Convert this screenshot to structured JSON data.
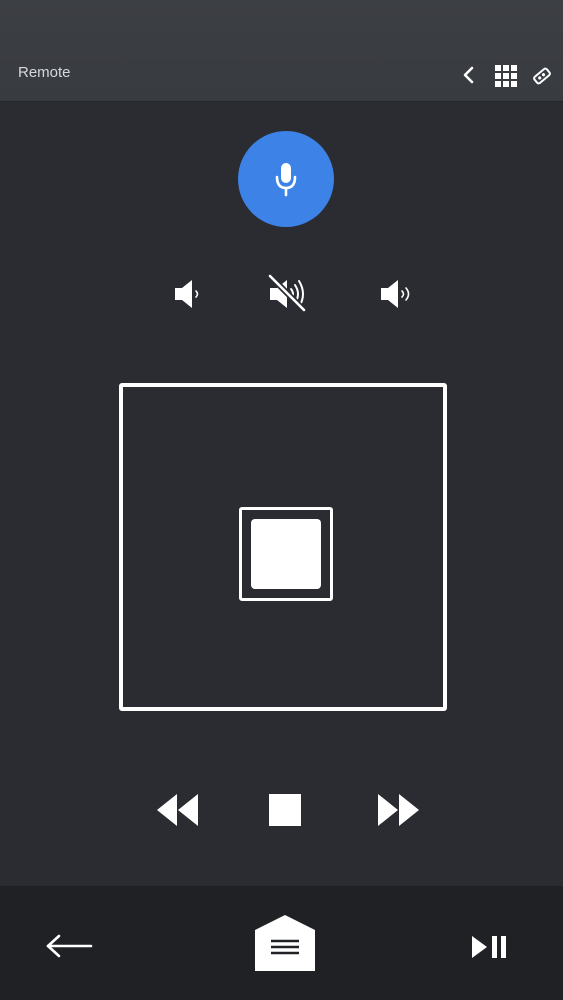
{
  "header": {
    "title": "Remote",
    "icons": [
      "chevron-left-icon",
      "grid-icon",
      "remote-icon"
    ]
  },
  "voice": {
    "icon": "microphone-icon",
    "color": "#3d82e6"
  },
  "volume": {
    "items": [
      "volume-down-icon",
      "mute-icon",
      "volume-up-icon"
    ]
  },
  "dpad": {
    "center_icon": "ok-square-icon"
  },
  "media": {
    "items": [
      "rewind-icon",
      "stop-icon",
      "fast-forward-icon"
    ]
  },
  "bottom_bar": {
    "items": [
      "back-arrow-icon",
      "home-menu-icon",
      "play-pause-icon"
    ]
  },
  "colors": {
    "background": "#2a2c31",
    "header": "#3c3f44",
    "bottom_bar": "#1f2125",
    "accent": "#3d82e6",
    "foreground": "#ffffff"
  }
}
